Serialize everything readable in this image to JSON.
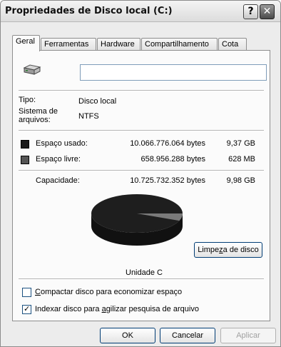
{
  "window": {
    "title": "Propriedades de Disco local (C:)",
    "help_glyph": "?",
    "close_glyph": "✕"
  },
  "tabs": [
    {
      "label": "Geral",
      "active": true
    },
    {
      "label": "Ferramentas",
      "active": false
    },
    {
      "label": "Hardware",
      "active": false
    },
    {
      "label": "Compartilhamento",
      "active": false
    },
    {
      "label": "Cota",
      "active": false
    }
  ],
  "general": {
    "drive_icon": "hard-drive-icon",
    "volume_name": "",
    "type_label": "Tipo:",
    "type_value": "Disco local",
    "fs_label_line1": "Sistema de",
    "fs_label_line2": "arquivos:",
    "fs_value": "NTFS"
  },
  "space": {
    "used": {
      "label": "Espaço usado:",
      "bytes": "10.066.776.064 bytes",
      "short": "9,37 GB",
      "color": "#1a1a1a"
    },
    "free": {
      "label": "Espaço livre:",
      "bytes": "658.956.288 bytes",
      "short": "628 MB",
      "color": "#555555"
    },
    "capacity": {
      "label": "Capacidade:",
      "bytes": "10.725.732.352 bytes",
      "short": "9,98 GB"
    }
  },
  "chart": {
    "used_fraction": 0.9386,
    "drive_label": "Unidade C"
  },
  "cleanup_button": {
    "prefix": "Limpe",
    "accel": "z",
    "suffix": "a de disco"
  },
  "options": {
    "compress": {
      "accel": "C",
      "rest": "ompactar disco para economizar espaço",
      "checked": false
    },
    "index": {
      "prefix": "Indexar disco para ",
      "accel": "a",
      "rest": "gilizar pesquisa de arquivo",
      "checked": true,
      "check_glyph": "✓"
    }
  },
  "buttons": {
    "ok": "OK",
    "cancel": "Cancelar",
    "apply": "Aplicar"
  }
}
